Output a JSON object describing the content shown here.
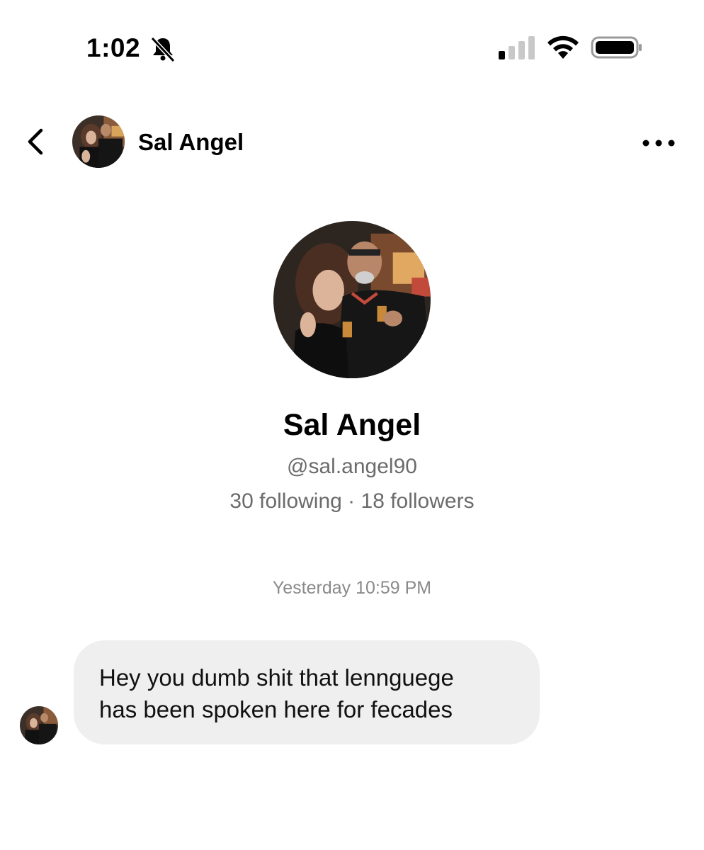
{
  "status_bar": {
    "time": "1:02",
    "icons": [
      "bell-muted-icon",
      "signal-icon",
      "wifi-icon",
      "battery-icon"
    ]
  },
  "header": {
    "back_icon": "chevron-left-icon",
    "name": "Sal Angel",
    "more_icon": "ellipsis-icon"
  },
  "profile": {
    "name": "Sal Angel",
    "handle": "@sal.angel90",
    "stats": "30 following · 18 followers"
  },
  "conversation": {
    "timestamp": "Yesterday 10:59 PM",
    "messages": [
      {
        "text": "Hey you dumb shit that lennguege\nhas been spoken here for fecades"
      }
    ]
  },
  "colors": {
    "background": "#ffffff",
    "bubble": "#efefef",
    "secondary_text": "#6b6b6b",
    "timestamp_text": "#8a8a8a"
  }
}
